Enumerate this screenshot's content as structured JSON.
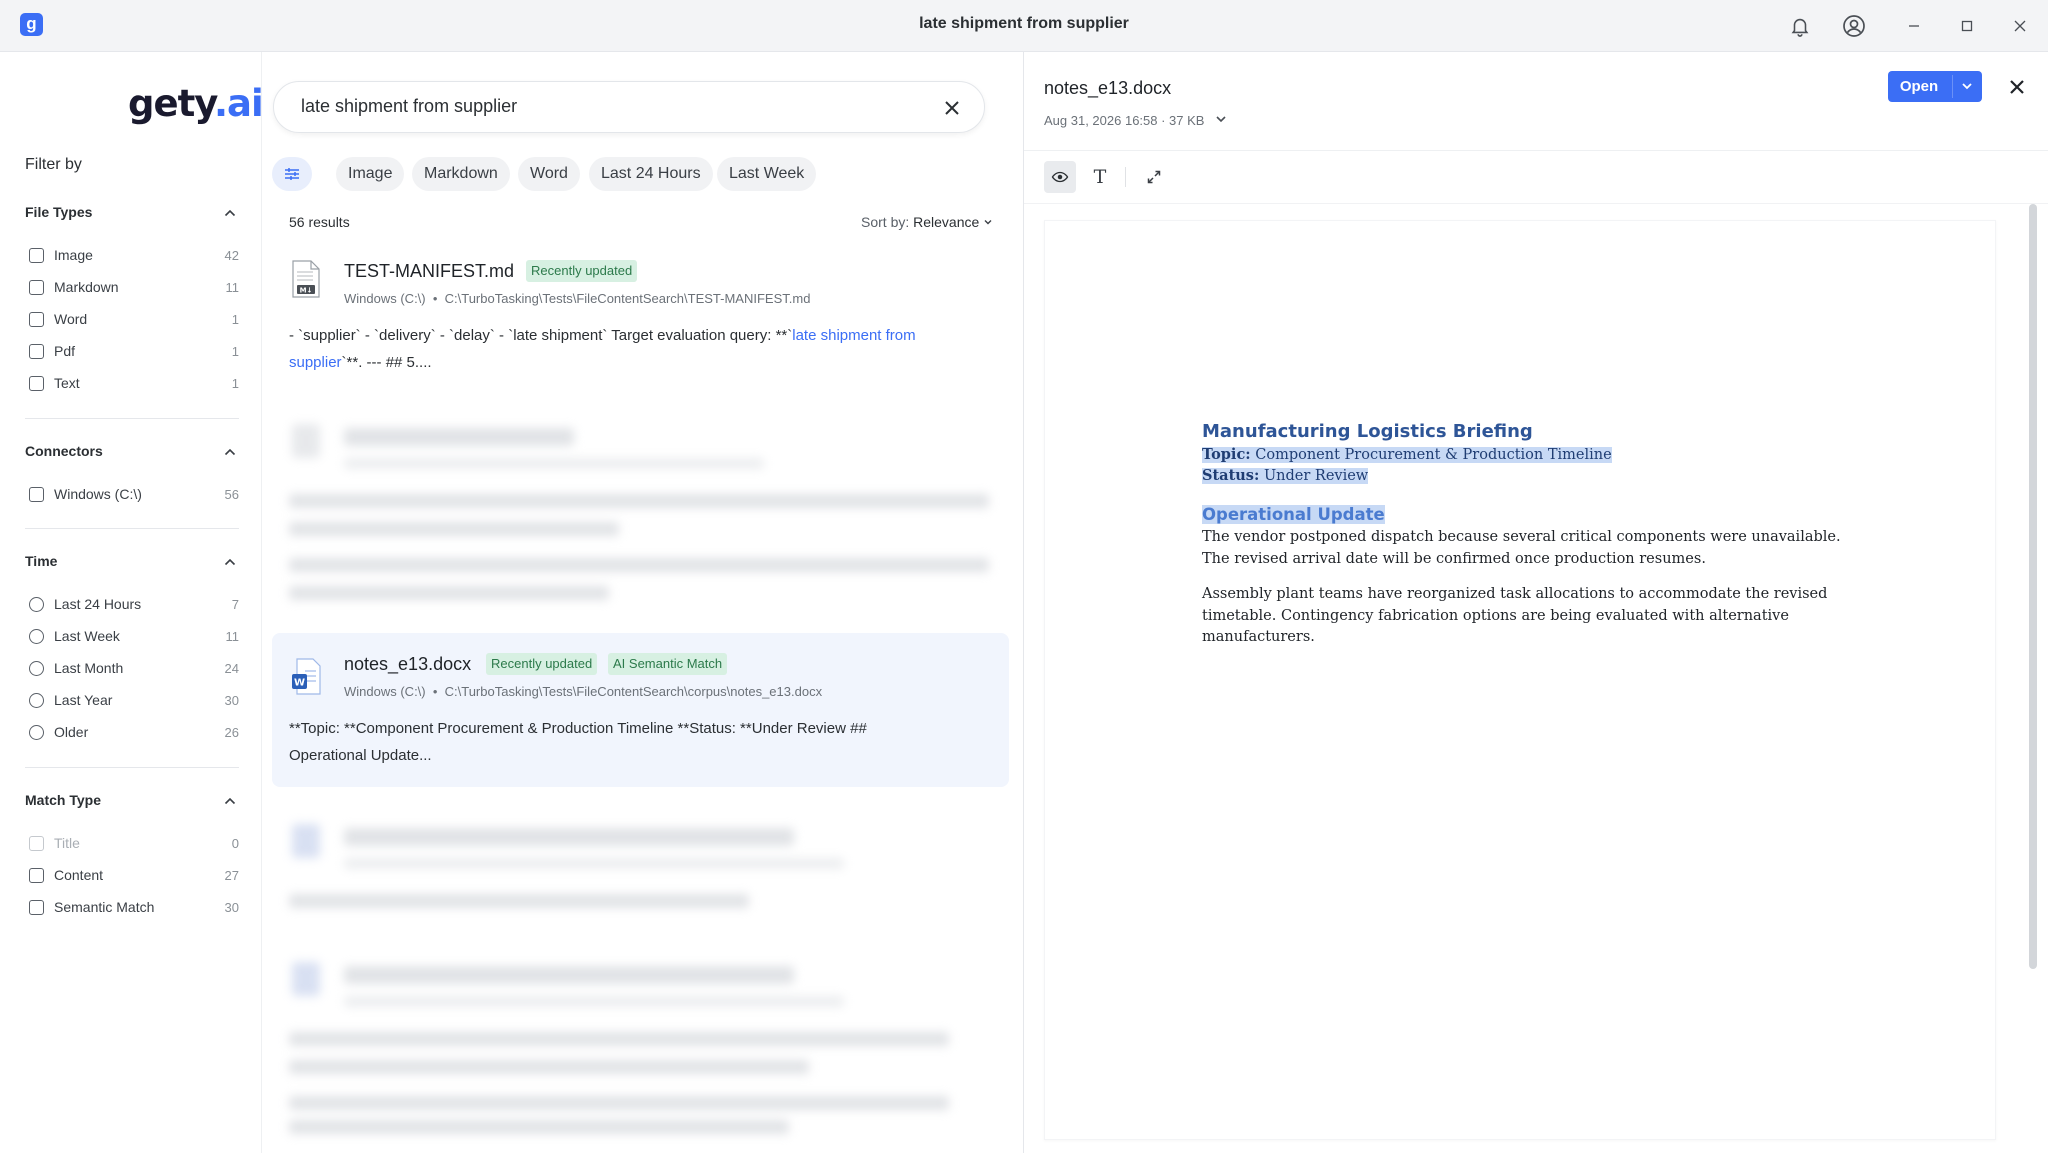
{
  "window": {
    "title": "late shipment from supplier",
    "app_icon_letter": "g"
  },
  "sidebar": {
    "logo_text": "gety",
    "logo_suffix": ".ai",
    "filter_by": "Filter by",
    "file_types": {
      "title": "File Types",
      "items": [
        {
          "label": "Image",
          "count": "42"
        },
        {
          "label": "Markdown",
          "count": "11"
        },
        {
          "label": "Word",
          "count": "1"
        },
        {
          "label": "Pdf",
          "count": "1"
        },
        {
          "label": "Text",
          "count": "1"
        }
      ]
    },
    "connectors": {
      "title": "Connectors",
      "items": [
        {
          "label": "Windows (C:\\)",
          "count": "56"
        }
      ]
    },
    "time": {
      "title": "Time",
      "items": [
        {
          "label": "Last 24 Hours",
          "count": "7"
        },
        {
          "label": "Last Week",
          "count": "11"
        },
        {
          "label": "Last Month",
          "count": "24"
        },
        {
          "label": "Last Year",
          "count": "30"
        },
        {
          "label": "Older",
          "count": "26"
        }
      ]
    },
    "match_type": {
      "title": "Match Type",
      "items": [
        {
          "label": "Title",
          "count": "0"
        },
        {
          "label": "Content",
          "count": "27"
        },
        {
          "label": "Semantic Match",
          "count": "30"
        }
      ]
    }
  },
  "search": {
    "query": "late shipment from supplier"
  },
  "chips": [
    "Image",
    "Markdown",
    "Word",
    "Last 24 Hours",
    "Last Week"
  ],
  "results_count": "56 results",
  "sort": {
    "label": "Sort by:",
    "value": "Relevance"
  },
  "results": [
    {
      "title": "TEST-MANIFEST.md",
      "badges": [
        "Recently updated"
      ],
      "source": "Windows (C:\\)",
      "path": "C:\\TurboTasking\\Tests\\FileContentSearch\\TEST-MANIFEST.md",
      "snippet_a": "- `supplier` - `delivery` - `delay` - `late shipment` Target evaluation query: **`",
      "snippet_hl": "late shipment from supplier",
      "snippet_b": "`**. --- ## 5...."
    },
    {
      "title": "notes_e13.docx",
      "badges": [
        "Recently updated",
        "AI Semantic Match"
      ],
      "source": "Windows (C:\\)",
      "path": "C:\\TurboTasking\\Tests\\FileContentSearch\\corpus\\notes_e13.docx",
      "snippet": "**Topic: **Component Procurement & Production Timeline **Status: **Under Review ## Operational Update..."
    }
  ],
  "preview": {
    "filename": "notes_e13.docx",
    "meta": "Aug 31, 2026 16:58 · 37 KB",
    "open_label": "Open",
    "doc": {
      "heading": "Manufacturing Logistics Briefing",
      "topic_label": "Topic:",
      "topic_value": "Component Procurement & Production Timeline",
      "status_label": "Status:",
      "status_value": "Under Review",
      "subheading": "Operational Update",
      "para1": "The vendor postponed dispatch because several critical components were unavailable. The revised arrival date will be confirmed once production resumes.",
      "para2": "Assembly plant teams have reorganized task allocations to accommodate the revised timetable. Contingency fabrication options are being evaluated with alternative manufacturers."
    }
  },
  "colors": {
    "accent": "#3b6ef5",
    "badge_bg": "#d7f0e2",
    "badge_fg": "#2c7a4b",
    "selected_row": "#f1f5fd",
    "doc_heading": "#2e5597"
  }
}
